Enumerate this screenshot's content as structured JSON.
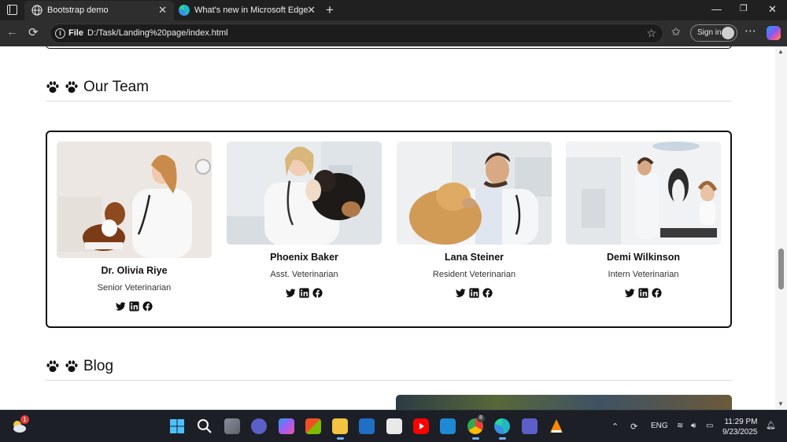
{
  "browser": {
    "tabs": [
      {
        "title": "Bootstrap demo",
        "active": true,
        "icon": "globe-icon"
      },
      {
        "title": "What's new in Microsoft Edge",
        "active": false,
        "icon": "edge-icon"
      }
    ],
    "address_scheme": "File",
    "address_url": "D:/Task/Landing%20page/index.html",
    "signin_label": "Sign in"
  },
  "page": {
    "team_section": {
      "title": "Our Team",
      "members": [
        {
          "name": "Dr. Olivia Riye",
          "role": "Senior Veterinarian",
          "photo": "vet-with-beagle"
        },
        {
          "name": "Phoenix Baker",
          "role": "Asst. Veterinarian",
          "photo": "vet-with-puppy"
        },
        {
          "name": "Lana Steiner",
          "role": "Resident Veterinarian",
          "photo": "vet-with-golden-retriever"
        },
        {
          "name": "Demi Wilkinson",
          "role": "Intern Veterinarian",
          "photo": "vet-with-husky"
        }
      ],
      "social_icons": [
        "twitter-icon",
        "linkedin-icon",
        "facebook-icon"
      ]
    },
    "blog_section": {
      "title": "Blog"
    }
  },
  "taskbar": {
    "notification_badge": "1",
    "chrome_badge": "8",
    "language": "ENG",
    "time": "11:29 PM",
    "date": "9/23/2025"
  }
}
